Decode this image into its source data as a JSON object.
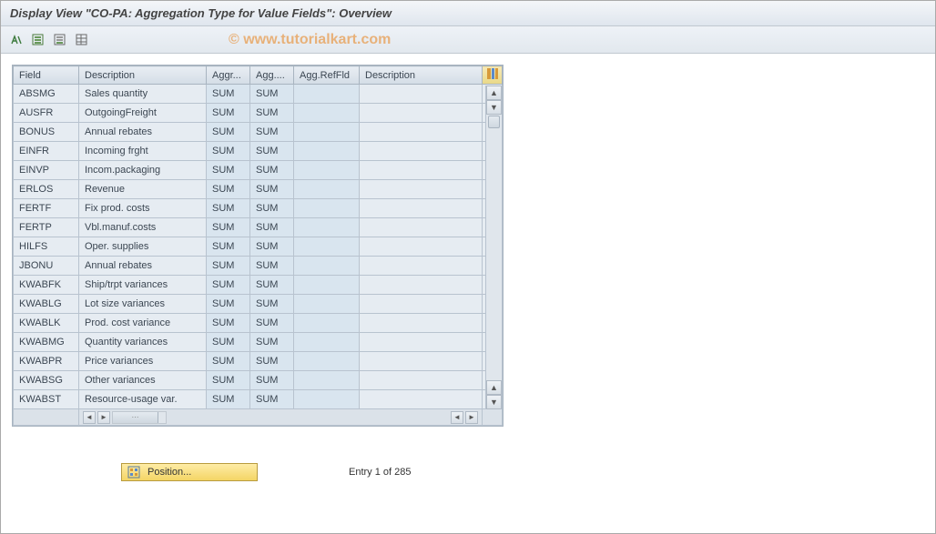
{
  "title": "Display View \"CO-PA: Aggregation Type for Value Fields\": Overview",
  "watermark": "© www.tutorialkart.com",
  "columns": {
    "field": "Field",
    "description": "Description",
    "aggr": "Aggr...",
    "agg2": "Agg....",
    "aggreffld": "Agg.RefFld",
    "description2": "Description"
  },
  "rows": [
    {
      "field": "ABSMG",
      "desc": "Sales quantity",
      "aggr": "SUM",
      "agg2": "SUM",
      "aggref": "",
      "desc2": ""
    },
    {
      "field": "AUSFR",
      "desc": "OutgoingFreight",
      "aggr": "SUM",
      "agg2": "SUM",
      "aggref": "",
      "desc2": ""
    },
    {
      "field": "BONUS",
      "desc": "Annual rebates",
      "aggr": "SUM",
      "agg2": "SUM",
      "aggref": "",
      "desc2": ""
    },
    {
      "field": "EINFR",
      "desc": "Incoming frght",
      "aggr": "SUM",
      "agg2": "SUM",
      "aggref": "",
      "desc2": ""
    },
    {
      "field": "EINVP",
      "desc": "Incom.packaging",
      "aggr": "SUM",
      "agg2": "SUM",
      "aggref": "",
      "desc2": ""
    },
    {
      "field": "ERLOS",
      "desc": "Revenue",
      "aggr": "SUM",
      "agg2": "SUM",
      "aggref": "",
      "desc2": ""
    },
    {
      "field": "FERTF",
      "desc": "Fix prod. costs",
      "aggr": "SUM",
      "agg2": "SUM",
      "aggref": "",
      "desc2": ""
    },
    {
      "field": "FERTP",
      "desc": "Vbl.manuf.costs",
      "aggr": "SUM",
      "agg2": "SUM",
      "aggref": "",
      "desc2": ""
    },
    {
      "field": "HILFS",
      "desc": "Oper. supplies",
      "aggr": "SUM",
      "agg2": "SUM",
      "aggref": "",
      "desc2": ""
    },
    {
      "field": "JBONU",
      "desc": "Annual rebates",
      "aggr": "SUM",
      "agg2": "SUM",
      "aggref": "",
      "desc2": ""
    },
    {
      "field": "KWABFK",
      "desc": "Ship/trpt variances",
      "aggr": "SUM",
      "agg2": "SUM",
      "aggref": "",
      "desc2": ""
    },
    {
      "field": "KWABLG",
      "desc": "Lot size variances",
      "aggr": "SUM",
      "agg2": "SUM",
      "aggref": "",
      "desc2": ""
    },
    {
      "field": "KWABLK",
      "desc": "Prod. cost variance",
      "aggr": "SUM",
      "agg2": "SUM",
      "aggref": "",
      "desc2": ""
    },
    {
      "field": "KWABMG",
      "desc": "Quantity variances",
      "aggr": "SUM",
      "agg2": "SUM",
      "aggref": "",
      "desc2": ""
    },
    {
      "field": "KWABPR",
      "desc": "Price variances",
      "aggr": "SUM",
      "agg2": "SUM",
      "aggref": "",
      "desc2": ""
    },
    {
      "field": "KWABSG",
      "desc": "Other variances",
      "aggr": "SUM",
      "agg2": "SUM",
      "aggref": "",
      "desc2": ""
    },
    {
      "field": "KWABST",
      "desc": "Resource-usage var.",
      "aggr": "SUM",
      "agg2": "SUM",
      "aggref": "",
      "desc2": ""
    }
  ],
  "footer": {
    "position_label": "Position...",
    "entry_text": "Entry 1 of 285"
  }
}
